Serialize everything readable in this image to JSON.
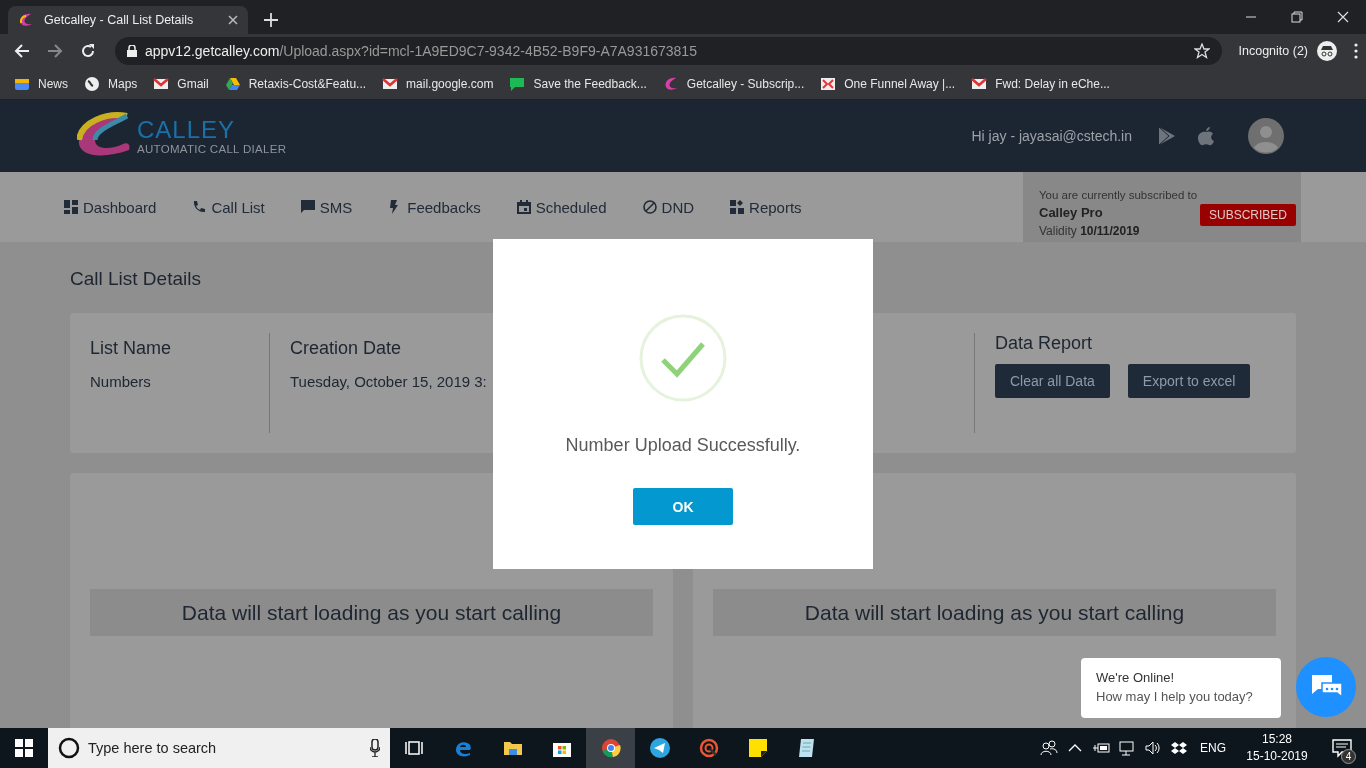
{
  "browser": {
    "tab_title": "Getcalley - Call List Details",
    "url_host": "appv12.getcalley.com",
    "url_path": "/Upload.aspx?id=mcl-1A9ED9C7-9342-4B52-B9F9-A7A931673815",
    "profile": "Incognito (2)",
    "bookmarks": [
      {
        "label": "News"
      },
      {
        "label": "Maps"
      },
      {
        "label": "Gmail"
      },
      {
        "label": "Retaxis-Cost&Featu..."
      },
      {
        "label": "mail.google.com"
      },
      {
        "label": "Save the Feedback..."
      },
      {
        "label": "Getcalley - Subscrip..."
      },
      {
        "label": "One Funnel Away |..."
      },
      {
        "label": "Fwd: Delay in eChe..."
      }
    ]
  },
  "header": {
    "brand": "CALLEY",
    "tagline": "AUTOMATIC CALL DIALER",
    "greeting": "Hi jay - jayasai@cstech.in"
  },
  "nav": [
    {
      "label": "Dashboard"
    },
    {
      "label": "Call List"
    },
    {
      "label": "SMS"
    },
    {
      "label": "Feedbacks"
    },
    {
      "label": "Scheduled"
    },
    {
      "label": "DND"
    },
    {
      "label": "Reports"
    }
  ],
  "subscription": {
    "intro": "You are currently subscribed to",
    "plan": "Calley Pro",
    "validity_label": "Validity",
    "validity_date": "10/11/2019",
    "badge": "SUBSCRIBED"
  },
  "page_title": "Call List Details",
  "list_card": {
    "fields": [
      {
        "label": "List Name",
        "value": "Numbers"
      },
      {
        "label": "Creation Date",
        "value": "Tuesday, October 15, 2019 3:"
      }
    ],
    "data_report": {
      "title": "Data Report",
      "buttons": [
        "Clear all Data",
        "Export to excel"
      ]
    }
  },
  "panels": [
    {
      "message": "Data will start loading as you start calling"
    },
    {
      "message": "Data will start loading as you start calling"
    }
  ],
  "modal": {
    "message": "Number Upload Successfully.",
    "button": "OK"
  },
  "chat": {
    "title": "We're Online!",
    "subtitle": "How may I help you today?"
  },
  "taskbar": {
    "search_placeholder": "Type here to search",
    "language": "ENG",
    "time": "15:28",
    "date": "15-10-2019",
    "notification_count": "4"
  }
}
